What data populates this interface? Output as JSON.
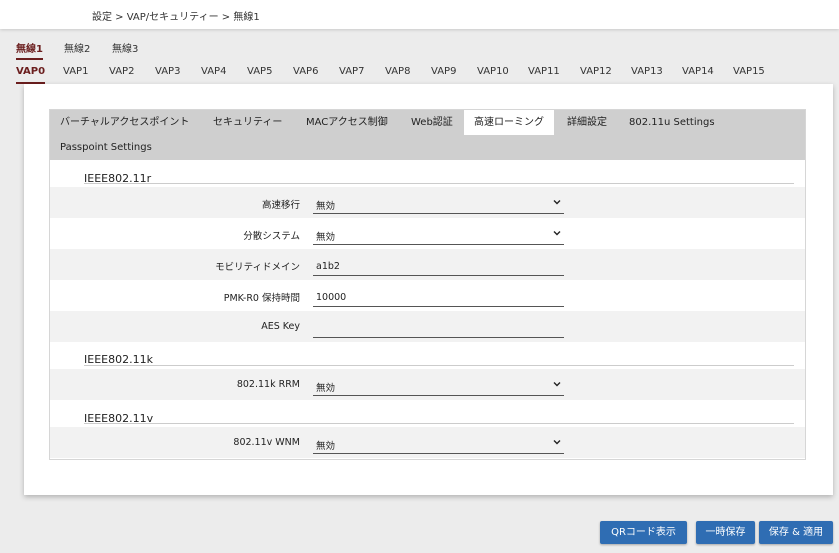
{
  "breadcrumb": "設定 > VAP/セキュリティー > 無線1",
  "radio_tabs": [
    "無線1",
    "無線2",
    "無線3"
  ],
  "radio_active": "無線1",
  "vap_tabs": [
    "VAP0",
    "VAP1",
    "VAP2",
    "VAP3",
    "VAP4",
    "VAP5",
    "VAP6",
    "VAP7",
    "VAP8",
    "VAP9",
    "VAP10",
    "VAP11",
    "VAP12",
    "VAP13",
    "VAP14",
    "VAP15"
  ],
  "vap_active": "VAP0",
  "sub_tabs": [
    "バーチャルアクセスポイント",
    "セキュリティー",
    "MACアクセス制御",
    "Web認証",
    "高速ローミング",
    "詳細設定",
    "802.11u Settings",
    "Passpoint Settings"
  ],
  "sub_active": "高速ローミング",
  "sections": {
    "r": {
      "title": "IEEE802.11r",
      "fast_transition": {
        "label": "高速移行",
        "value": "無効"
      },
      "distributed_system": {
        "label": "分散システム",
        "value": "無効"
      },
      "mobility_domain": {
        "label": "モビリティドメイン",
        "value": "a1b2"
      },
      "pmk_r0": {
        "label": "PMK-R0 保持時間",
        "value": "10000"
      },
      "aes_key": {
        "label": "AES Key",
        "value": ""
      }
    },
    "k": {
      "title": "IEEE802.11k",
      "rrm": {
        "label": "802.11k RRM",
        "value": "無効"
      }
    },
    "v": {
      "title": "IEEE802.11v",
      "wnm": {
        "label": "802.11v WNM",
        "value": "無効"
      }
    }
  },
  "buttons": {
    "qr": "QRコード表示",
    "temp_save": "一時保存",
    "save_apply": "保存 & 適用"
  },
  "colors": {
    "accent": "#6b1e1e",
    "button": "#2f6db3",
    "subtab_bar": "#cfcfcf"
  }
}
